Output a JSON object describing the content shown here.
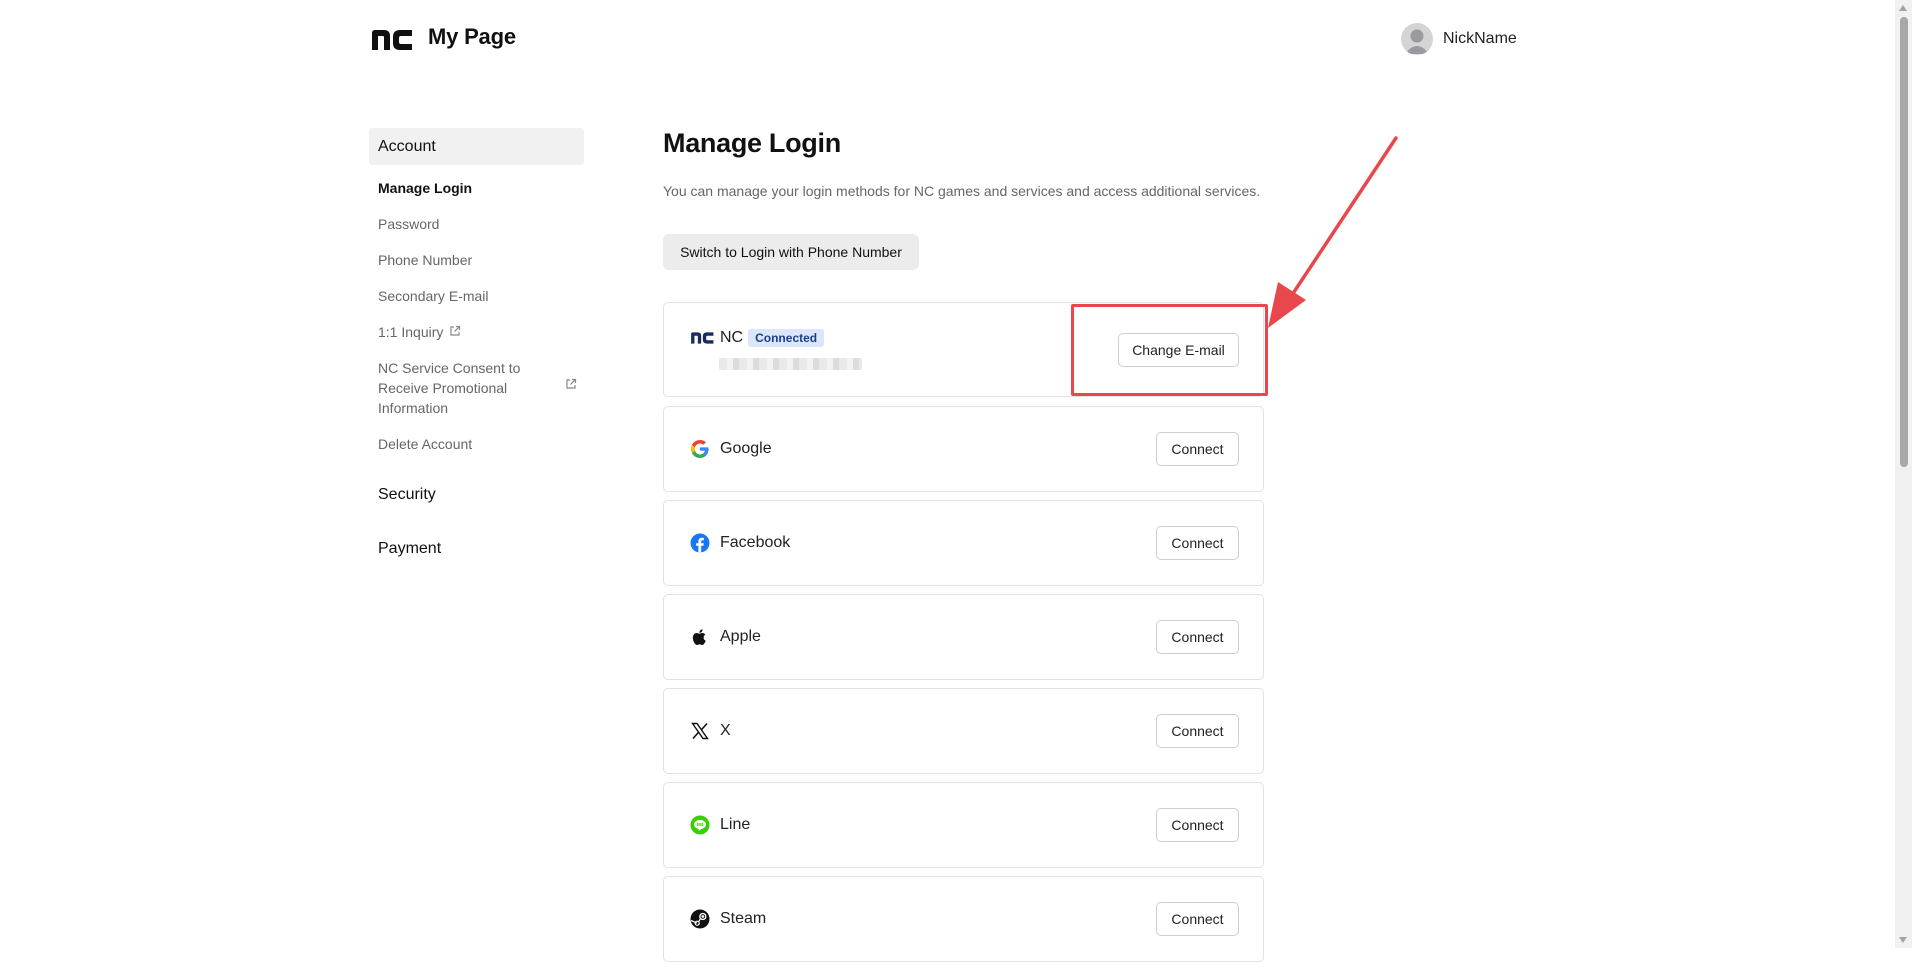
{
  "header": {
    "logo": "nc-logo",
    "title": "My Page",
    "nickname": "NickName"
  },
  "sidebar": {
    "account_label": "Account",
    "items": [
      {
        "label": "Manage Login"
      },
      {
        "label": "Password"
      },
      {
        "label": "Phone Number"
      },
      {
        "label": "Secondary E-mail"
      },
      {
        "label": "1:1 Inquiry"
      },
      {
        "label": "NC Service Consent to Receive Promotional Information"
      },
      {
        "label": "Delete Account"
      }
    ],
    "security_label": "Security",
    "payment_label": "Payment"
  },
  "main": {
    "title": "Manage Login",
    "description": "You can manage your login methods for NC games and services and access additional services.",
    "switch_button": "Switch to Login with Phone Number",
    "nc": {
      "name": "NC",
      "badge": "Connected",
      "change_email_button": "Change E-mail"
    },
    "connect_label": "Connect",
    "providers": [
      {
        "name": "Google",
        "icon": "google-icon"
      },
      {
        "name": "Facebook",
        "icon": "facebook-icon"
      },
      {
        "name": "Apple",
        "icon": "apple-icon"
      },
      {
        "name": "X",
        "icon": "x-icon"
      },
      {
        "name": "Line",
        "icon": "line-icon"
      },
      {
        "name": "Steam",
        "icon": "steam-icon"
      }
    ]
  },
  "colors": {
    "annotation_red": "#e8474c",
    "badge_bg": "#dbe6fb",
    "badge_text": "#1b3f86",
    "nc_blue": "#1a2b5c"
  }
}
